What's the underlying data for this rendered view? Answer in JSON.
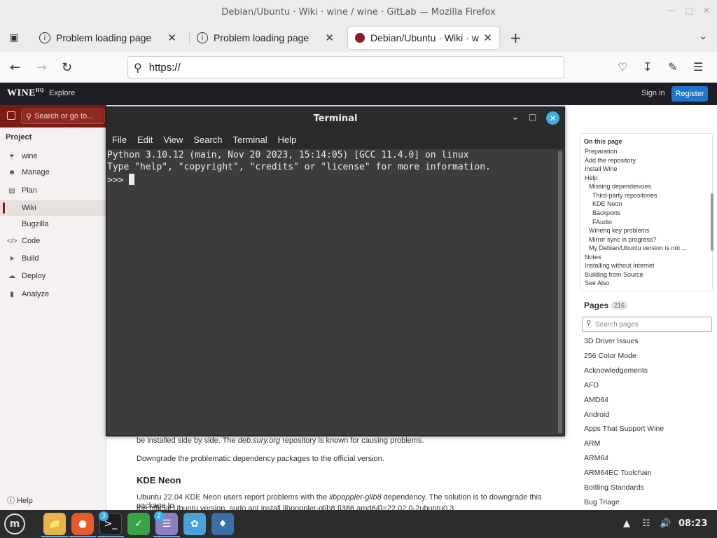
{
  "window": {
    "title": "Debian/Ubuntu · Wiki · wine / wine · GitLab — Mozilla Firefox"
  },
  "tabs": [
    {
      "label": "Problem loading page"
    },
    {
      "label": "Problem loading page"
    },
    {
      "label": "Debian/Ubuntu · Wiki · wine / wine · GitLab"
    }
  ],
  "navbar": {
    "url": "https://"
  },
  "gitlab": {
    "logo": "WINE",
    "logo_sup": "HQ",
    "explore": "Explore",
    "sign_in": "Sign in",
    "register": "Register",
    "search_placeholder": "Search or go to...",
    "project_label": "Project",
    "sidebar_items": [
      {
        "label": "wine",
        "icon": "wine-glass-icon"
      },
      {
        "label": "Manage",
        "icon": "users-icon"
      },
      {
        "label": "Plan",
        "icon": "calendar-icon"
      },
      {
        "label": "Wiki",
        "icon": "none"
      },
      {
        "label": "Bugzilla",
        "icon": "none"
      },
      {
        "label": "Code",
        "icon": "code-icon"
      },
      {
        "label": "Build",
        "icon": "rocket-icon"
      },
      {
        "label": "Deploy",
        "icon": "cloud-icon"
      },
      {
        "label": "Analyze",
        "icon": "chart-icon"
      }
    ],
    "help": "Help"
  },
  "content": {
    "line1_prefix": "be installed side by side. The ",
    "line1_em": "deb.sury.org",
    "line1_suffix": " repository is known for causing problems.",
    "downgrade": "Downgrade the problematic dependency packages to the official version.",
    "kde_heading": "KDE Neon",
    "kde_text_prefix": "Ubuntu 22.04 KDE Neon users report problems with the ",
    "kde_text_em": "libpoppler-glib8",
    "kde_text_suffix": " dependency. The solution is to downgrade this package to",
    "kde_text_2": "the official Ubuntu version. sudo apt install libpoppler-glib8:{i386,amd64}=22.02.0-2ubuntu0.3"
  },
  "toc": {
    "title": "On this page",
    "items": [
      {
        "label": "Preparation",
        "level": 0
      },
      {
        "label": "Add the repository",
        "level": 0
      },
      {
        "label": "Install Wine",
        "level": 0
      },
      {
        "label": "Help",
        "level": 0
      },
      {
        "label": "Missing dependencies",
        "level": 1
      },
      {
        "label": "Third-party repositories",
        "level": 2
      },
      {
        "label": "KDE Neon",
        "level": 2
      },
      {
        "label": "Backports",
        "level": 2
      },
      {
        "label": "FAudio",
        "level": 2
      },
      {
        "label": "Winehq key problems",
        "level": 1
      },
      {
        "label": "Mirror sync in progress?",
        "level": 1
      },
      {
        "label": "My Debian/Ubuntu version is not ...",
        "level": 1
      },
      {
        "label": "Notes",
        "level": 0
      },
      {
        "label": "Installing without Internet",
        "level": 0
      },
      {
        "label": "Building from Source",
        "level": 0
      },
      {
        "label": "See Also",
        "level": 0
      }
    ]
  },
  "pages": {
    "title": "Pages",
    "count": "216",
    "search_placeholder": "Search pages",
    "items": [
      "3D Driver Issues",
      "256 Color Mode",
      "Acknowledgements",
      "AFD",
      "AMD64",
      "Android",
      "Apps That Support Wine",
      "ARM",
      "ARM64",
      "ARM64EC Toolchain",
      "Bottling Standards",
      "Bug Triage"
    ]
  },
  "terminal": {
    "title": "Terminal",
    "menu": [
      "File",
      "Edit",
      "View",
      "Search",
      "Terminal",
      "Help"
    ],
    "lines": [
      "Python 3.10.12 (main, Nov 20 2023, 15:14:05) [GCC 11.4.0] on linux",
      "Type \"help\", \"copyright\", \"credits\" or \"license\" for more information.",
      ">>> "
    ]
  },
  "taskbar": {
    "badges": {
      "terminal": "3",
      "editor": "2"
    },
    "clock": "08:23"
  }
}
